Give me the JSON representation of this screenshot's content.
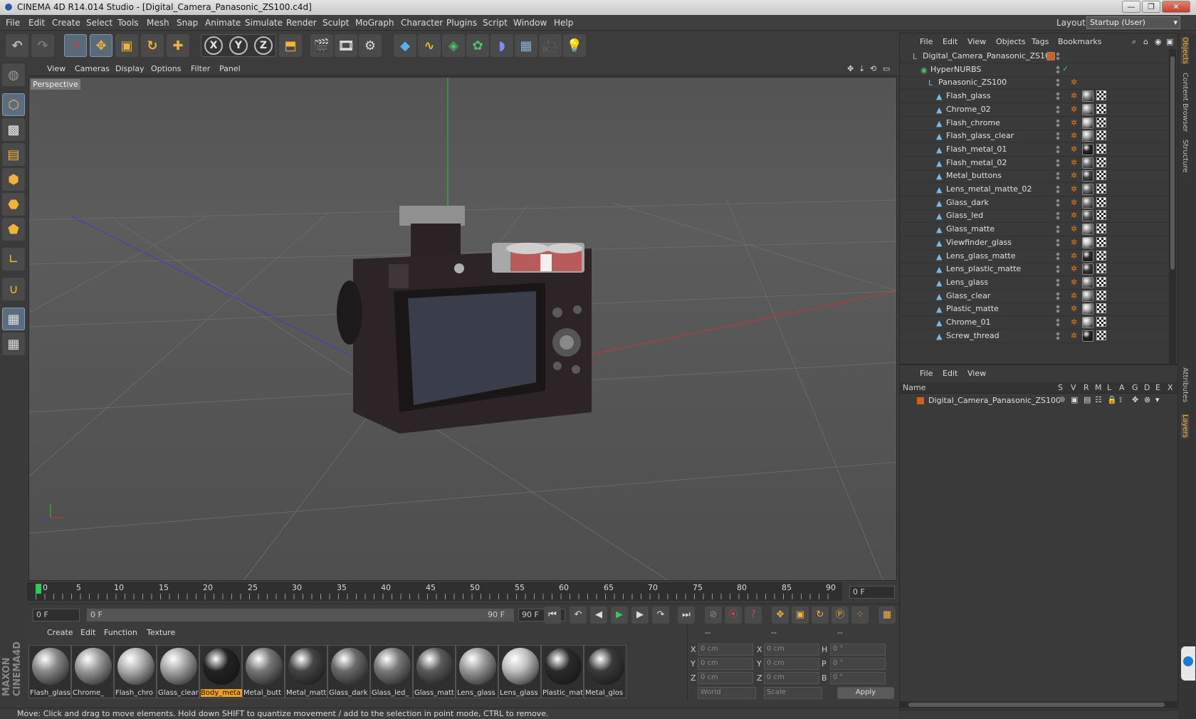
{
  "window": {
    "title": "CINEMA 4D R14.014 Studio - [Digital_Camera_Panasonic_ZS100.c4d]",
    "layout_label": "Layout:",
    "layout_value": "Startup (User)"
  },
  "menu": [
    "File",
    "Edit",
    "Create",
    "Select",
    "Tools",
    "Mesh",
    "Snap",
    "Animate",
    "Simulate",
    "Render",
    "Sculpt",
    "MoGraph",
    "Character",
    "Plugins",
    "Script",
    "Window",
    "Help"
  ],
  "axes": [
    "X",
    "Y",
    "Z"
  ],
  "viewport": {
    "menu": [
      "View",
      "Cameras",
      "Display",
      "Options",
      "Filter",
      "Panel"
    ],
    "label": "Perspective"
  },
  "timeline": {
    "ticks": [
      "0",
      "5",
      "10",
      "15",
      "20",
      "25",
      "30",
      "35",
      "40",
      "45",
      "50",
      "55",
      "60",
      "65",
      "70",
      "75",
      "80",
      "85",
      "90"
    ],
    "current_frame": "0 F"
  },
  "transport": {
    "start": "0 F",
    "range_start": "0 F",
    "range_end": "90 F",
    "end": "90 F"
  },
  "materials": {
    "menu": [
      "Create",
      "Edit",
      "Function",
      "Texture"
    ],
    "items": [
      {
        "label": "Flash_glass",
        "color": "#8a8a8a",
        "selected": false
      },
      {
        "label": "Chrome_",
        "color": "#9a9a9a",
        "selected": false
      },
      {
        "label": "Flash_chro",
        "color": "#b0b0b0",
        "selected": false
      },
      {
        "label": "Glass_clear",
        "color": "#a8a8a8",
        "selected": false
      },
      {
        "label": "Body_meta",
        "color": "#222222",
        "selected": true
      },
      {
        "label": "Metal_butt",
        "color": "#777777",
        "selected": false
      },
      {
        "label": "Metal_matt",
        "color": "#444444",
        "selected": false
      },
      {
        "label": "Glass_dark",
        "color": "#6a6a6a",
        "selected": false
      },
      {
        "label": "Glass_led_",
        "color": "#7a7a7a",
        "selected": false
      },
      {
        "label": "Glass_matt",
        "color": "#5a5a5a",
        "selected": false
      },
      {
        "label": "Lens_glass",
        "color": "#9a9a9a",
        "selected": false
      },
      {
        "label": "Lens_glass",
        "color": "#c0c0c0",
        "selected": false
      },
      {
        "label": "Plastic_mat",
        "color": "#2a2a2a",
        "selected": false
      },
      {
        "label": "Metal_glos",
        "color": "#3a3a3a",
        "selected": false
      }
    ]
  },
  "coordinates": {
    "headers": [
      "--",
      "--",
      "--"
    ],
    "rows": [
      {
        "a": "X",
        "av": "0 cm",
        "b": "X",
        "bv": "0 cm",
        "c": "H",
        "cv": "0 °"
      },
      {
        "a": "Y",
        "av": "0 cm",
        "b": "Y",
        "bv": "0 cm",
        "c": "P",
        "cv": "0 °"
      },
      {
        "a": "Z",
        "av": "0 cm",
        "b": "Z",
        "bv": "0 cm",
        "c": "B",
        "cv": "0 °"
      }
    ],
    "world": "World",
    "scale": "Scale",
    "apply": "Apply"
  },
  "status": "Move: Click and drag to move elements. Hold down SHIFT to quantize movement / add to the selection in point mode, CTRL to remove.",
  "objects": {
    "menu": [
      "File",
      "Edit",
      "View",
      "Objects",
      "Tags",
      "Bookmarks"
    ],
    "tree": [
      {
        "name": "Digital_Camera_Panasonic_ZS100",
        "level": 0,
        "icon": "null"
      },
      {
        "name": "HyperNURBS",
        "level": 1,
        "icon": "nurbs"
      },
      {
        "name": "Panasonic_ZS100",
        "level": 2,
        "icon": "null"
      },
      {
        "name": "Flash_glass",
        "level": 3,
        "icon": "poly"
      },
      {
        "name": "Chrome_02",
        "level": 3,
        "icon": "poly"
      },
      {
        "name": "Flash_chrome",
        "level": 3,
        "icon": "poly"
      },
      {
        "name": "Flash_glass_clear",
        "level": 3,
        "icon": "poly"
      },
      {
        "name": "Flash_metal_01",
        "level": 3,
        "icon": "poly"
      },
      {
        "name": "Flash_metal_02",
        "level": 3,
        "icon": "poly"
      },
      {
        "name": "Metal_buttons",
        "level": 3,
        "icon": "poly"
      },
      {
        "name": "Lens_metal_matte_02",
        "level": 3,
        "icon": "poly"
      },
      {
        "name": "Glass_dark",
        "level": 3,
        "icon": "poly"
      },
      {
        "name": "Glass_led",
        "level": 3,
        "icon": "poly"
      },
      {
        "name": "Glass_matte",
        "level": 3,
        "icon": "poly"
      },
      {
        "name": "Viewfinder_glass",
        "level": 3,
        "icon": "poly"
      },
      {
        "name": "Lens_glass_matte",
        "level": 3,
        "icon": "poly"
      },
      {
        "name": "Lens_plastic_matte",
        "level": 3,
        "icon": "poly"
      },
      {
        "name": "Lens_glass",
        "level": 3,
        "icon": "poly"
      },
      {
        "name": "Glass_clear",
        "level": 3,
        "icon": "poly"
      },
      {
        "name": "Plastic_matte",
        "level": 3,
        "icon": "poly"
      },
      {
        "name": "Chrome_01",
        "level": 3,
        "icon": "poly"
      },
      {
        "name": "Screw_thread",
        "level": 3,
        "icon": "poly"
      }
    ]
  },
  "layers": {
    "menu": [
      "File",
      "Edit",
      "View"
    ],
    "columns": [
      "Name",
      "S",
      "V",
      "R",
      "M",
      "L",
      "A",
      "G",
      "D",
      "E",
      "X"
    ],
    "rows": [
      {
        "name": "Digital_Camera_Panasonic_ZS100",
        "color": "#d06020"
      }
    ]
  },
  "right_tabs": [
    "Objects",
    "Content Browser",
    "Structure",
    "Attributes",
    "Layers"
  ]
}
